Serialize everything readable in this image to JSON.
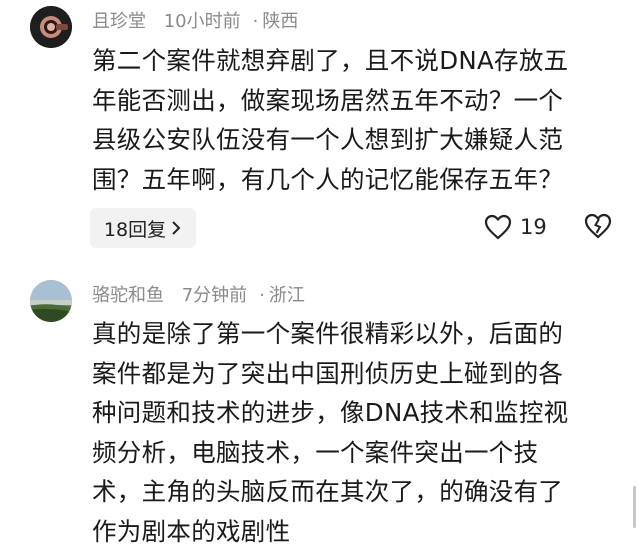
{
  "comments": [
    {
      "username": "且珍堂",
      "time": "10小时前",
      "location": "陕西",
      "lines": [
        "第二个案件就想弃剧了，且不说DNA存放五",
        "年能否测出，做案现场居然五年不动？一个",
        "县级公安队伍没有一个人想到扩大嫌疑人范",
        "围？五年啊，有几个人的记忆能保存五年？"
      ],
      "reply_label": "18回复",
      "likes": "19"
    },
    {
      "username": "骆驼和鱼",
      "time": "7分钟前",
      "location": "浙江",
      "lines": [
        "真的是除了第一个案件很精彩以外，后面的",
        "案件都是为了突出中国刑侦历史上碰到的各",
        "种问题和技术的进步，像DNA技术和监控视",
        "频分析，电脑技术，一个案件突出一个技",
        "术，主角的头脑反而在其次了，的确没有了",
        "作为剧本的戏剧性"
      ]
    }
  ],
  "separator": "·"
}
